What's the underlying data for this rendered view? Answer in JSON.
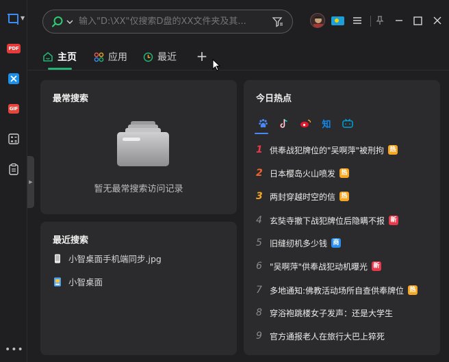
{
  "search": {
    "placeholder": "输入\"D:\\XX\"仅搜索D盘的XX文件夹及其..."
  },
  "rail": {
    "pdf_badge": "PDF",
    "gif_badge": "GIF",
    "more": "•••"
  },
  "tabs": [
    {
      "label": "主页",
      "active": true
    },
    {
      "label": "应用",
      "active": false
    },
    {
      "label": "最近",
      "active": false
    }
  ],
  "tab_add": "+",
  "frequent": {
    "title": "最常搜索",
    "empty_text": "暂无最常搜索访问记录"
  },
  "recent": {
    "title": "最近搜索",
    "items": [
      {
        "label": "小智桌面手机端同步.jpg",
        "icon": "phone-image-icon"
      },
      {
        "label": "小智桌面",
        "icon": "app-shortcut-icon"
      }
    ]
  },
  "hot": {
    "title": "今日热点",
    "sources": [
      {
        "name": "baidu",
        "icon": "paw-icon",
        "active": true
      },
      {
        "name": "douyin",
        "icon": "music-note-icon"
      },
      {
        "name": "weibo",
        "icon": "weibo-icon"
      },
      {
        "name": "zhihu",
        "icon": "zhihu-icon",
        "text": "知"
      },
      {
        "name": "bilibili",
        "icon": "tv-icon"
      }
    ],
    "items": [
      {
        "rank": "1",
        "title": "供奉战犯牌位的\"吴啊萍\"被刑拘",
        "tag": "热",
        "tag_type": "hot"
      },
      {
        "rank": "2",
        "title": "日本樱岛火山喷发",
        "tag": "热",
        "tag_type": "hot"
      },
      {
        "rank": "3",
        "title": "两封穿越时空的信",
        "tag": "热",
        "tag_type": "hot"
      },
      {
        "rank": "4",
        "title": "玄奘寺撤下战犯牌位后隐瞒不报",
        "tag": "新",
        "tag_type": "new"
      },
      {
        "rank": "5",
        "title": "旧缝纫机多少钱",
        "tag": "商",
        "tag_type": "biz"
      },
      {
        "rank": "6",
        "title": "\"吴啊萍\"供奉战犯动机曝光",
        "tag": "新",
        "tag_type": "new"
      },
      {
        "rank": "7",
        "title": "多地通知:佛教活动场所自查供奉牌位",
        "tag": "热",
        "tag_type": "hot"
      },
      {
        "rank": "8",
        "title": "穿浴袍跳楼女子发声：还是大学生",
        "tag": "",
        "tag_type": ""
      },
      {
        "rank": "9",
        "title": "官方通报老人在旅行大巴上猝死",
        "tag": "",
        "tag_type": ""
      }
    ]
  },
  "colors": {
    "accent_green": "#22b573",
    "hot": "#f5a623",
    "new": "#e8394c",
    "biz": "#2b8ef0"
  }
}
